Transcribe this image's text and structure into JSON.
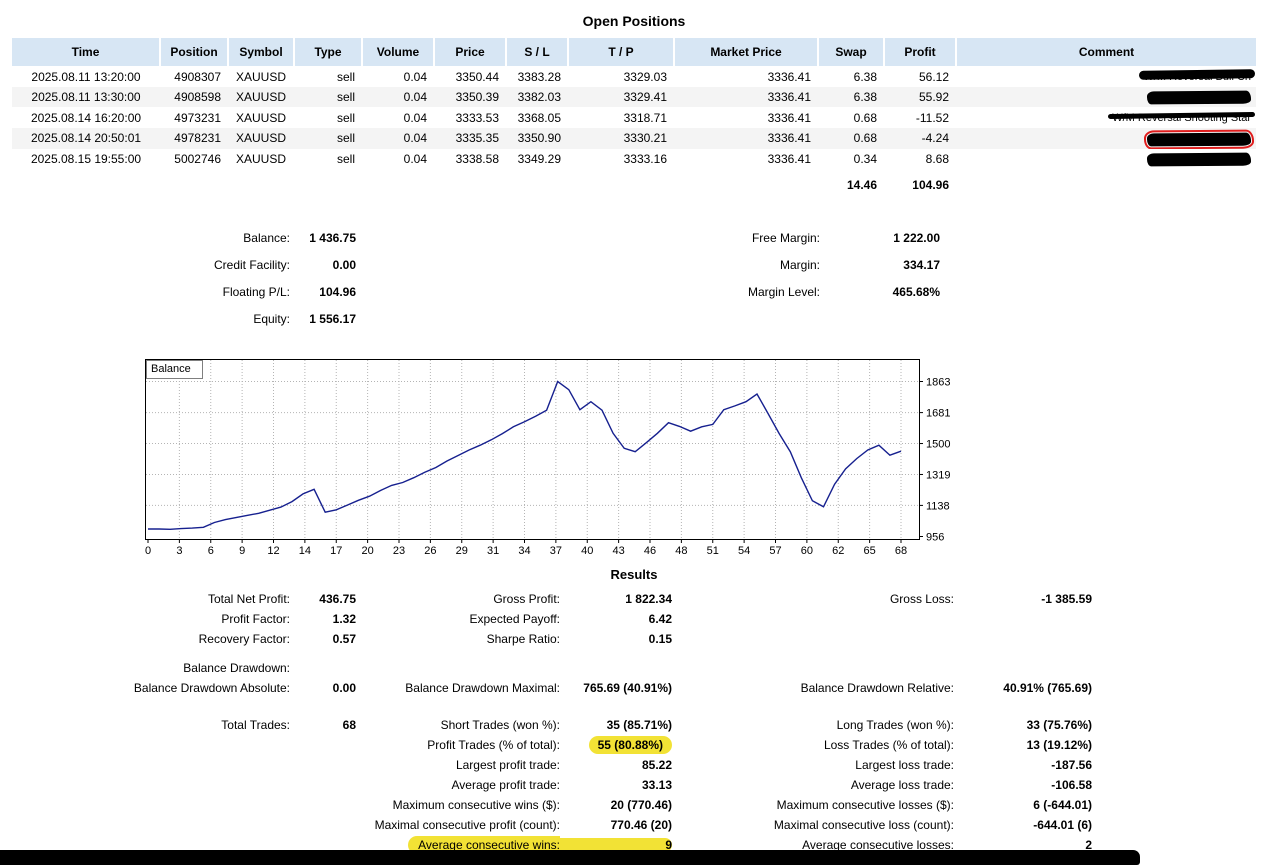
{
  "header": {
    "title": "Open Positions"
  },
  "positions_table": {
    "columns": [
      "Time",
      "Position",
      "Symbol",
      "Type",
      "Volume",
      "Price",
      "S / L",
      "T / P",
      "Market Price",
      "Swap",
      "Profit",
      "Comment"
    ],
    "rows": [
      {
        "time": "2025.08.11 13:20:00",
        "position": "4908307",
        "symbol": "XAUUSD",
        "type": "sell",
        "volume": "0.04",
        "price": "3350.44",
        "sl": "3383.28",
        "tp": "3329.03",
        "market_price": "3336.41",
        "swap": "6.38",
        "profit": "56.12",
        "comment": {
          "kind": "scribbled-text",
          "weight": "heavy",
          "text": "W/M Reversal Bull Ch"
        }
      },
      {
        "time": "2025.08.11 13:30:00",
        "position": "4908598",
        "symbol": "XAUUSD",
        "type": "sell",
        "volume": "0.04",
        "price": "3350.39",
        "sl": "3382.03",
        "tp": "3329.41",
        "market_price": "3336.41",
        "swap": "6.38",
        "profit": "55.92",
        "comment": {
          "kind": "blob",
          "red_box": false
        }
      },
      {
        "time": "2025.08.14 16:20:00",
        "position": "4973231",
        "symbol": "XAUUSD",
        "type": "sell",
        "volume": "0.04",
        "price": "3333.53",
        "sl": "3368.05",
        "tp": "3318.71",
        "market_price": "3336.41",
        "swap": "0.68",
        "profit": "-11.52",
        "comment": {
          "kind": "scribbled-text",
          "weight": "light",
          "text": "W/M Reversal Shooting Star"
        }
      },
      {
        "time": "2025.08.14 20:50:01",
        "position": "4978231",
        "symbol": "XAUUSD",
        "type": "sell",
        "volume": "0.04",
        "price": "3335.35",
        "sl": "3350.90",
        "tp": "3330.21",
        "market_price": "3336.41",
        "swap": "0.68",
        "profit": "-4.24",
        "comment": {
          "kind": "blob",
          "red_box": true
        }
      },
      {
        "time": "2025.08.15 19:55:00",
        "position": "5002746",
        "symbol": "XAUUSD",
        "type": "sell",
        "volume": "0.04",
        "price": "3338.58",
        "sl": "3349.29",
        "tp": "3333.16",
        "market_price": "3336.41",
        "swap": "0.34",
        "profit": "8.68",
        "comment": {
          "kind": "blob",
          "red_box": false
        }
      }
    ],
    "totals": {
      "swap": "14.46",
      "profit": "104.96"
    }
  },
  "summary": {
    "left": [
      {
        "label": "Balance:",
        "value": "1 436.75"
      },
      {
        "label": "Credit Facility:",
        "value": "0.00"
      },
      {
        "label": "Floating P/L:",
        "value": "104.96"
      },
      {
        "label": "Equity:",
        "value": "1 556.17"
      }
    ],
    "right": [
      {
        "label": "Free Margin:",
        "value": "1 222.00"
      },
      {
        "label": "Margin:",
        "value": "334.17"
      },
      {
        "label": "Margin Level:",
        "value": "465.68%"
      }
    ]
  },
  "chart_data": {
    "type": "line",
    "title": "Balance",
    "legend_position": "top-left",
    "grid": true,
    "line_color": "#16208f",
    "xlim": [
      0,
      68
    ],
    "ylim": [
      956,
      2000
    ],
    "x_ticks": [
      0,
      3,
      6,
      9,
      12,
      14,
      17,
      20,
      23,
      26,
      29,
      31,
      34,
      37,
      40,
      43,
      46,
      48,
      51,
      54,
      57,
      60,
      62,
      65,
      68
    ],
    "y_ticks": [
      956,
      1138,
      1319,
      1500,
      1681,
      1863
    ],
    "series": [
      {
        "name": "Balance",
        "values": [
          1000,
          1000,
          998,
          1002,
          1005,
          1010,
          1038,
          1055,
          1068,
          1080,
          1092,
          1110,
          1128,
          1160,
          1205,
          1232,
          1098,
          1112,
          1140,
          1168,
          1192,
          1225,
          1255,
          1272,
          1300,
          1332,
          1360,
          1398,
          1430,
          1462,
          1490,
          1522,
          1558,
          1598,
          1628,
          1660,
          1695,
          1863,
          1815,
          1698,
          1745,
          1695,
          1560,
          1472,
          1452,
          1505,
          1560,
          1622,
          1600,
          1572,
          1598,
          1612,
          1698,
          1720,
          1745,
          1790,
          1675,
          1558,
          1452,
          1300,
          1165,
          1130,
          1262,
          1352,
          1412,
          1462,
          1490,
          1432,
          1455
        ]
      }
    ]
  },
  "results": {
    "title": "Results",
    "rows": [
      {
        "c1": [
          "Total Net Profit:",
          "436.75"
        ],
        "c2": [
          "Gross Profit:",
          "1 822.34"
        ],
        "c3": [
          "Gross Loss:",
          "-1 385.59"
        ]
      },
      {
        "c1": [
          "Profit Factor:",
          "1.32"
        ],
        "c2": [
          "Expected Payoff:",
          "6.42"
        ],
        "c3": [
          "",
          ""
        ]
      },
      {
        "c1": [
          "Recovery Factor:",
          "0.57"
        ],
        "c2": [
          "Sharpe Ratio:",
          "0.15"
        ],
        "c3": [
          "",
          ""
        ]
      },
      {
        "spacer": "sm"
      },
      {
        "c1": [
          "Balance Drawdown:",
          ""
        ],
        "c2": [
          "",
          ""
        ],
        "c3": [
          "",
          ""
        ]
      },
      {
        "c1": [
          "Balance Drawdown Absolute:",
          "0.00"
        ],
        "c2": [
          "Balance Drawdown Maximal:",
          "765.69 (40.91%)"
        ],
        "c3": [
          "Balance Drawdown Relative:",
          "40.91% (765.69)"
        ]
      },
      {
        "spacer": "md"
      },
      {
        "c1": [
          "Total Trades:",
          "68"
        ],
        "c2": [
          "Short Trades (won %):",
          "35 (85.71%)"
        ],
        "c3": [
          "Long Trades (won %):",
          "33 (75.76%)"
        ]
      },
      {
        "c1": [
          "",
          ""
        ],
        "c2": [
          "Profit Trades (% of total):",
          "55 (80.88%)"
        ],
        "c3": [
          "Loss Trades (% of total):",
          "13 (19.12%)"
        ],
        "hl": "c2v"
      },
      {
        "c1": [
          "",
          ""
        ],
        "c2": [
          "Largest profit trade:",
          "85.22"
        ],
        "c3": [
          "Largest loss trade:",
          "-187.56"
        ]
      },
      {
        "c1": [
          "",
          ""
        ],
        "c2": [
          "Average profit trade:",
          "33.13"
        ],
        "c3": [
          "Average loss trade:",
          "-106.58"
        ]
      },
      {
        "c1": [
          "",
          ""
        ],
        "c2": [
          "Maximum consecutive wins ($):",
          "20 (770.46)"
        ],
        "c3": [
          "Maximum consecutive losses ($):",
          "6 (-644.01)"
        ]
      },
      {
        "c1": [
          "",
          ""
        ],
        "c2": [
          "Maximal consecutive profit (count):",
          "770.46 (20)"
        ],
        "c3": [
          "Maximal consecutive loss (count):",
          "-644.01 (6)"
        ]
      },
      {
        "c1": [
          "",
          ""
        ],
        "c2": [
          "Average consecutive wins:",
          "9"
        ],
        "c3": [
          "Average consecutive losses:",
          "2"
        ],
        "hl": "c2lv"
      }
    ]
  }
}
